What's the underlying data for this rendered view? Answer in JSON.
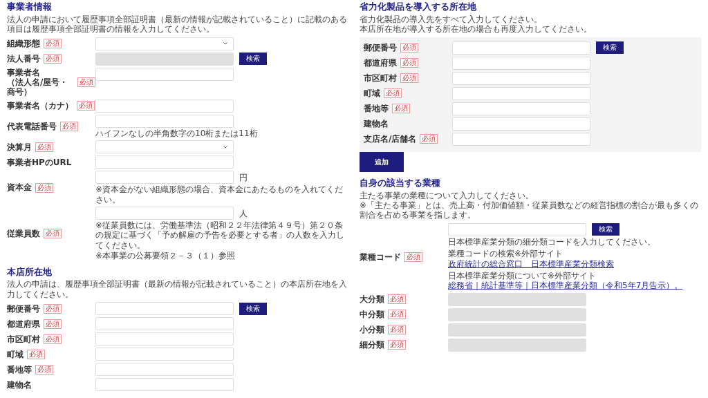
{
  "columns": [
    {
      "sections": [
        {
          "title": "事業者情報",
          "boxed": false,
          "descriptions": [
            "法人の申請において履歴事項全部証明書（最新の情報が記載されていること）に記載のある項目は履歴事項全部証明書の情報を入力してください。"
          ],
          "fields": [
            {
              "label": "組織形態",
              "badge": "必須",
              "kind": "select",
              "disabled": false
            },
            {
              "label": "法人番号",
              "badge": "必須",
              "kind": "text",
              "disabled": true,
              "button": "検索"
            },
            {
              "label_lines": [
                "事業者名",
                "（法人名/屋号・商号）"
              ],
              "badge": "必須",
              "kind": "text",
              "disabled": false
            },
            {
              "label": "事業者名（カナ）",
              "badge": "必須",
              "kind": "text",
              "disabled": false
            },
            {
              "label": "代表電話番号",
              "badge": "必須",
              "kind": "text",
              "disabled": false,
              "notes": [
                {
                  "text": "ハイフンなしの半角数字の10桁または11桁"
                }
              ]
            },
            {
              "label": "決算月",
              "badge": "必須",
              "kind": "select",
              "disabled": false
            },
            {
              "label": "事業者HPのURL",
              "kind": "text",
              "disabled": false
            },
            {
              "label": "資本金",
              "badge": "必須",
              "kind": "text",
              "disabled": false,
              "unit": "円",
              "notes": [
                {
                  "text": "※資本金がない組織形態の場合、資本金にあたるものを入れてください。"
                }
              ]
            },
            {
              "label": "従業員数",
              "badge": "必須",
              "kind": "text",
              "disabled": false,
              "unit": "人",
              "notes": [
                {
                  "text": "※従業員数には、労働基準法（昭和２２年法律第４９号）第２０条の規定に基づく「予め解雇の予告を必要とする者」の人数を入力してください。"
                },
                {
                  "text": "※本事業の公募要領２－３（１）参照"
                }
              ]
            }
          ]
        },
        {
          "title": "本店所在地",
          "boxed": false,
          "descriptions": [
            "法人の申請は、履歴事項全部証明書（最新の情報が記載されていること）の本店所在地を入力してください。"
          ],
          "fields": [
            {
              "label": "郵便番号",
              "badge": "必須",
              "kind": "text",
              "disabled": false,
              "button": "検索"
            },
            {
              "label": "都道府県",
              "badge": "必須",
              "kind": "text",
              "disabled": false
            },
            {
              "label": "市区町村",
              "badge": "必須",
              "kind": "text",
              "disabled": false
            },
            {
              "label": "町域",
              "badge": "必須",
              "kind": "text",
              "disabled": false
            },
            {
              "label": "番地等",
              "badge": "必須",
              "kind": "text",
              "disabled": false
            },
            {
              "label": "建物名",
              "kind": "text",
              "disabled": false
            }
          ]
        }
      ]
    },
    {
      "sections": [
        {
          "title": "省力化製品を導入する所在地",
          "boxed": true,
          "descriptions": [
            "省力化製品の導入先をすべて入力してください。",
            "本店所在地が導入する所在地の場合も再度入力してください。"
          ],
          "fields": [
            {
              "label": "郵便番号",
              "badge": "必須",
              "kind": "text",
              "disabled": false,
              "button": "検索"
            },
            {
              "label": "都道府県",
              "badge": "必須",
              "kind": "text",
              "disabled": false
            },
            {
              "label": "市区町村",
              "badge": "必須",
              "kind": "text",
              "disabled": false
            },
            {
              "label": "町域",
              "badge": "必須",
              "kind": "text",
              "disabled": false
            },
            {
              "label": "番地等",
              "badge": "必須",
              "kind": "text",
              "disabled": false
            },
            {
              "label": "建物名",
              "kind": "text",
              "disabled": false
            },
            {
              "label": "支店名/店舗名",
              "badge": "必須",
              "kind": "text",
              "disabled": false
            }
          ],
          "add_button": "追加"
        },
        {
          "title": "自身の該当する業種",
          "boxed": false,
          "descriptions": [
            "主たる事業の業種について入力してください。",
            "※「主たる事業」とは、売上高・付加価値額・従業員数などの経営指標の割合が最も多くの割合を占める事業を指します。"
          ],
          "fields": [
            {
              "label": "業種コード",
              "badge": "必須",
              "kind": "text",
              "disabled": false,
              "button": "検索",
              "notes": [
                {
                  "text": "日本標準産業分類の細分類コードを入力してください。"
                },
                {
                  "text": "業種コードの検索※外部サイト",
                  "link": "政府統計の総合窓口　日本標準産業分類検索"
                },
                {
                  "text": "日本標準産業分類について※外部サイト",
                  "link": "総務省｜統計基準等｜日本標準産業分類（令和5年7月告示）。"
                }
              ]
            },
            {
              "label": "大分類",
              "badge": "必須",
              "kind": "text",
              "disabled": true
            },
            {
              "label": "中分類",
              "badge": "必須",
              "kind": "text",
              "disabled": true
            },
            {
              "label": "小分類",
              "badge": "必須",
              "kind": "text",
              "disabled": true
            },
            {
              "label": "細分類",
              "badge": "必須",
              "kind": "text",
              "disabled": true
            }
          ]
        }
      ]
    }
  ]
}
